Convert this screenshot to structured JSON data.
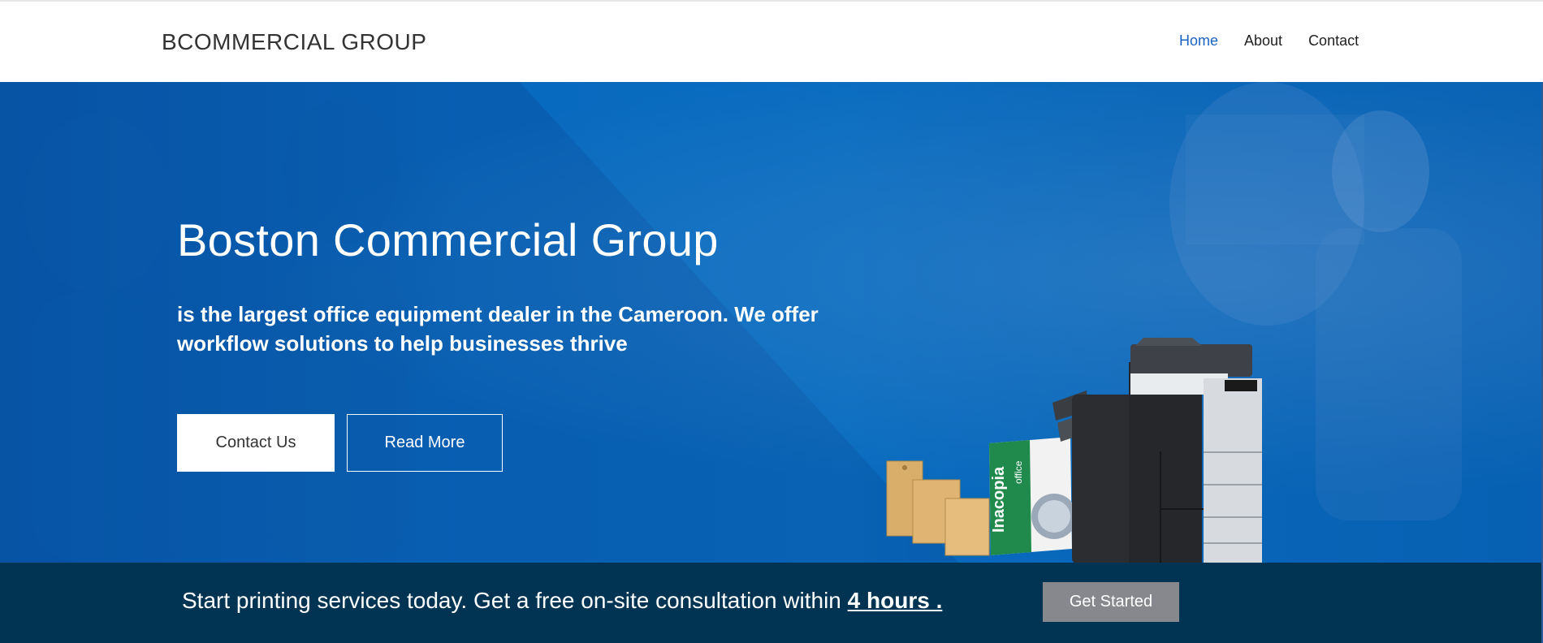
{
  "header": {
    "brand": "BCOMMERCIAL GROUP",
    "nav": [
      {
        "label": "Home",
        "active": true
      },
      {
        "label": "About",
        "active": false
      },
      {
        "label": "Contact",
        "active": false
      }
    ]
  },
  "hero": {
    "title": "Boston Commercial Group",
    "subtitle": "is the largest office equipment dealer in the Cameroon. We offer workflow solutions to help businesses thrive",
    "contact_button": "Contact Us",
    "read_more_button": "Read More",
    "product_box_brand": "Inacopia",
    "product_box_label": "office"
  },
  "cta_band": {
    "text": "Start printing services today. Get a free on-site consultation within ",
    "highlight": "4 hours .",
    "button": "Get Started"
  },
  "colors": {
    "accent": "#1a63c4",
    "hero_blue": "#0864b8",
    "band": "#003452",
    "button_gray": "#87888d"
  }
}
